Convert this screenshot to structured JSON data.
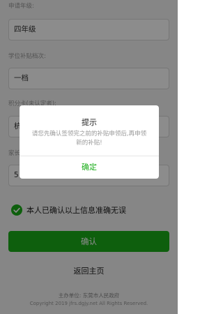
{
  "form": {
    "fields": [
      {
        "label": "申请年级:",
        "value": "四年级"
      },
      {
        "label": "学位补贴档次:",
        "value": "一档"
      },
      {
        "label": "积分卡(未认定者):",
        "value": "杭"
      },
      {
        "label": "家长手机号:",
        "value": "5"
      }
    ],
    "confirm_text": "本人已确认以上信息准确无误",
    "confirm_checked": true,
    "submit_label": "确认",
    "home_label": "返回主页"
  },
  "footer": {
    "org": "主办单位:  东莞市人民政府",
    "copyright": "Copyright 2019 jfrs.dgjy.net All Rights Reserved."
  },
  "dialog": {
    "title": "提示",
    "message": "请您先确认签领完之前的补贴申领后,再申领新的补贴!",
    "ok_label": "确定"
  },
  "colors": {
    "accent": "#1aad19",
    "overlay": "rgba(0,0,0,0.45)"
  },
  "icons": {
    "check": "check-circle-icon"
  }
}
